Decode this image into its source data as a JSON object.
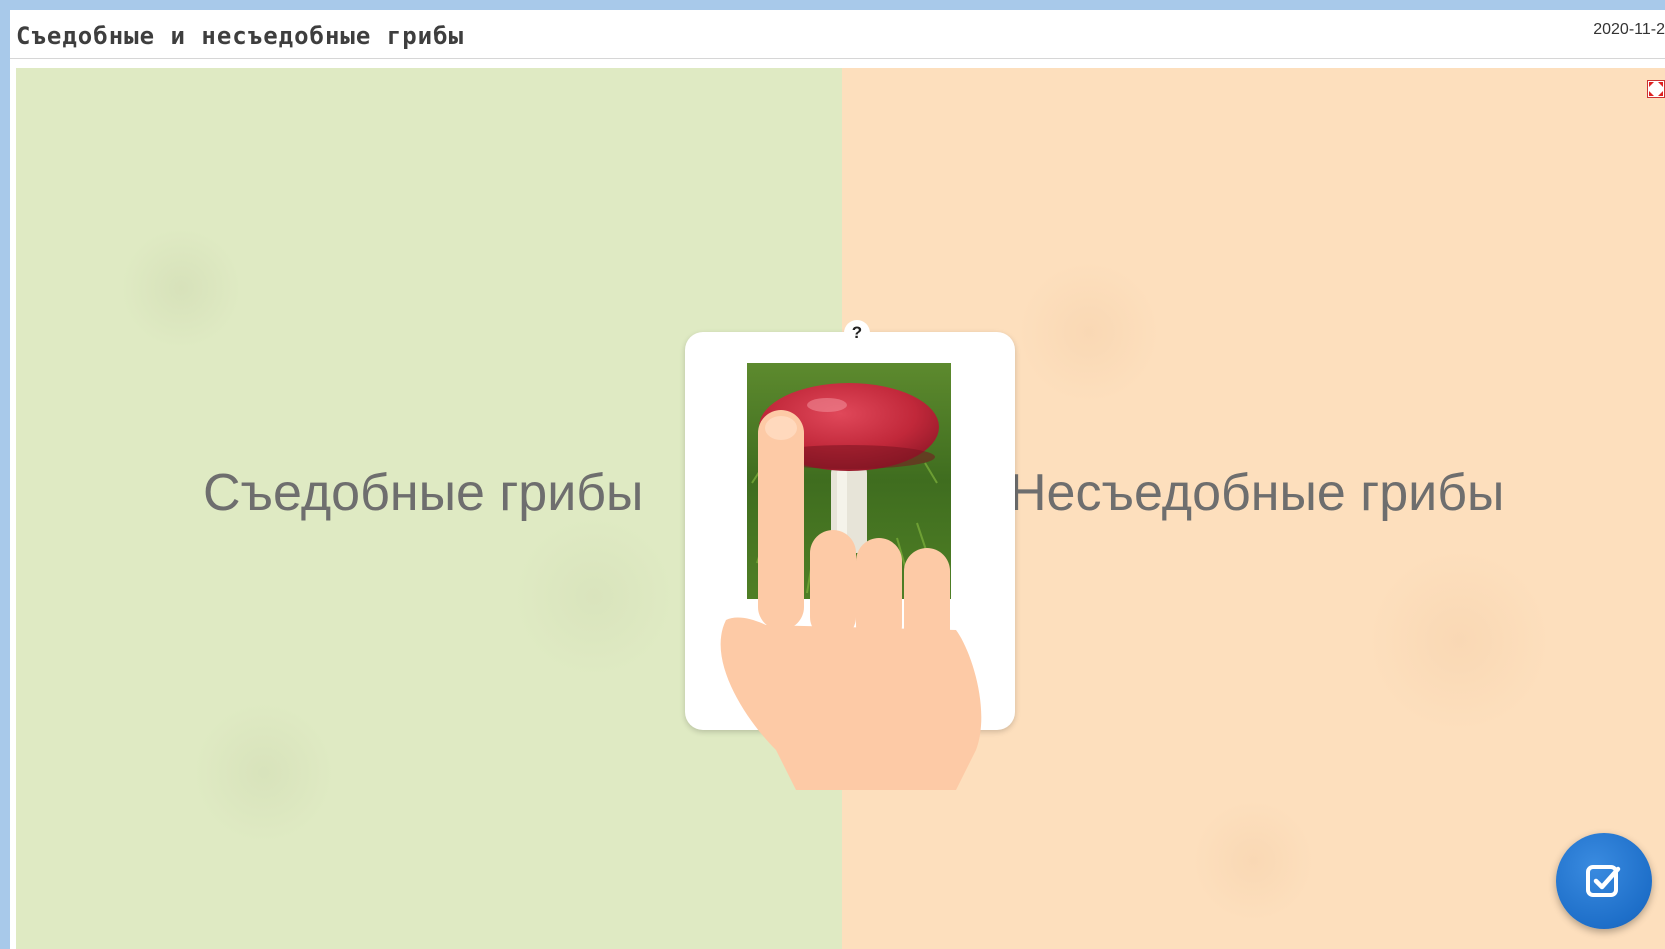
{
  "header": {
    "title": "Съедобные и несъедобные грибы",
    "date": "2020-11-2"
  },
  "zones": {
    "edible": {
      "label": "Съедобные грибы",
      "color": "#dfeac3"
    },
    "inedible": {
      "label": "Несъедобные грибы",
      "color": "#fddfbd"
    }
  },
  "card": {
    "badge": "?",
    "image_subject": "red-mushroom"
  },
  "icons": {
    "fullscreen": "fullscreen-icon",
    "hand": "hand-pointer-icon",
    "check": "check-square-icon"
  },
  "colors": {
    "accent": "#1e6fc9",
    "frame": "#a8c9ea"
  }
}
